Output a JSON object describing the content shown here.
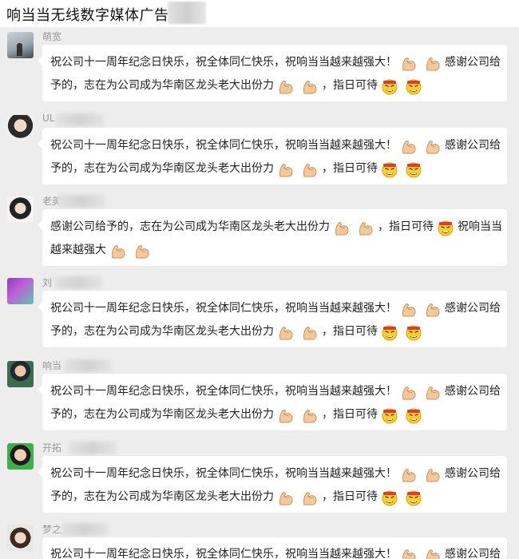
{
  "header": {
    "title": "响当当无线数字媒体广告"
  },
  "messages": [
    {
      "nick": "萌宽",
      "line1": {
        "a": "祝公司十一周年纪念日快乐，祝全体同仁快乐，祝响当当越来越强大！",
        "b": "感谢公司给"
      },
      "line2": {
        "a": "予的，志在为公司成为华南区龙头老大出份力",
        "b": "，指日可待"
      }
    },
    {
      "nick": "UL",
      "line1": {
        "a": "祝公司十一周年纪念日快乐，祝全体同仁快乐，祝响当当越来越强大！",
        "b": "感谢公司给"
      },
      "line2": {
        "a": "予的，志在为公司成为华南区龙头老大出份力",
        "b": "，指日可待"
      }
    },
    {
      "nick": "老美",
      "line1": {
        "a": "感谢公司给予的，志在为公司成为华南区龙头老大出份力",
        "b": "，指日可待",
        "c": "祝响当当"
      },
      "line2": {
        "a": "越来越强大"
      }
    },
    {
      "nick": "刘",
      "line1": {
        "a": "祝公司十一周年纪念日快乐，祝全体同仁快乐，祝响当当越来越强大！",
        "b": "感谢公司给"
      },
      "line2": {
        "a": "予的，志在为公司成为华南区龙头老大出份力",
        "b": "，指日可待"
      }
    },
    {
      "nick": "响当",
      "line1": {
        "a": "祝公司十一周年纪念日快乐，祝全体同仁快乐，祝响当当越来越强大！",
        "b": "感谢公司给"
      },
      "line2": {
        "a": "予的，志在为公司成为华南区龙头老大出份力",
        "b": "，指日可待"
      }
    },
    {
      "nick": "开拓",
      "line1": {
        "a": "祝公司十一周年纪念日快乐，祝全体同仁快乐，祝响当当越来越强大！",
        "b": "感谢公司给"
      },
      "line2": {
        "a": "予的，志在为公司成为华南区龙头老大出份力",
        "b": "，指日可待"
      }
    },
    {
      "nick": "梦之",
      "line1": {
        "a": "祝公司十一周年纪念日快乐，祝全体同仁快乐，祝响当当越来越强大！",
        "b": "感谢公司给"
      }
    }
  ],
  "icons": {
    "strong": "flexed-biceps-icon",
    "determined": "determined-face-icon"
  },
  "colors": {
    "background": "#ededed",
    "bubble": "#ffffff",
    "nickname": "#999999",
    "text": "#222222"
  }
}
